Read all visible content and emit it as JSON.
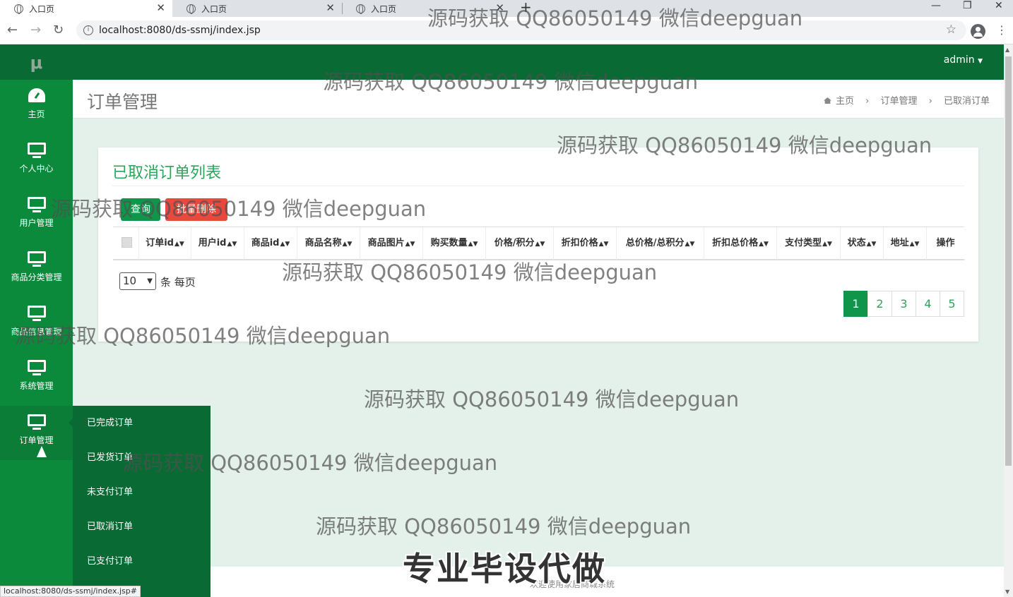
{
  "browser": {
    "tabs": [
      {
        "title": "入口页",
        "active": true
      },
      {
        "title": "入口页",
        "active": false
      },
      {
        "title": "入口页",
        "active": false
      }
    ],
    "url": "localhost:8080/ds-ssmj/index.jsp",
    "status_url": "localhost:8080/ds-ssmj/index.jsp#"
  },
  "sidebar": {
    "logo": "μ",
    "items": [
      {
        "label": "主页",
        "icon": "dashboard-icon"
      },
      {
        "label": "个人中心",
        "icon": "monitor-icon"
      },
      {
        "label": "用户管理",
        "icon": "monitor-icon"
      },
      {
        "label": "商品分类管理",
        "icon": "monitor-icon"
      },
      {
        "label": "商品信息管理",
        "icon": "monitor-icon"
      },
      {
        "label": "系统管理",
        "icon": "monitor-icon"
      },
      {
        "label": "订单管理",
        "icon": "monitor-icon"
      }
    ],
    "submenu": [
      "已完成订单",
      "已发货订单",
      "未支付订单",
      "已取消订单",
      "已支付订单"
    ]
  },
  "topbar": {
    "user": "admin"
  },
  "page": {
    "title": "订单管理",
    "breadcrumb": [
      "主页",
      "订单管理",
      "已取消订单"
    ],
    "list_title": "已取消订单列表",
    "query_button": "查询",
    "delete_button": "批量删除",
    "columns": [
      "订单id",
      "用户id",
      "商品id",
      "商品名称",
      "商品图片",
      "购买数量",
      "价格/积分",
      "折扣价格",
      "总价格/总积分",
      "折扣总价格",
      "支付类型",
      "状态",
      "地址",
      "操作"
    ],
    "page_size": "10",
    "page_size_label": "条 每页",
    "pages": [
      "1",
      "2",
      "3",
      "4",
      "5"
    ],
    "current_page": "1"
  },
  "footer": {
    "text": "欢迎使用家居商城系统"
  },
  "overlay": {
    "watermark": "源码获取 QQ86050149 微信deepguan",
    "promo": "专业毕设代做"
  },
  "colors": {
    "sidebar": "#0b8a3c",
    "sidebar_dark": "#0a6a34",
    "accent": "#2aa65b",
    "danger": "#e8493d",
    "content_bg": "#e4f1ea"
  }
}
